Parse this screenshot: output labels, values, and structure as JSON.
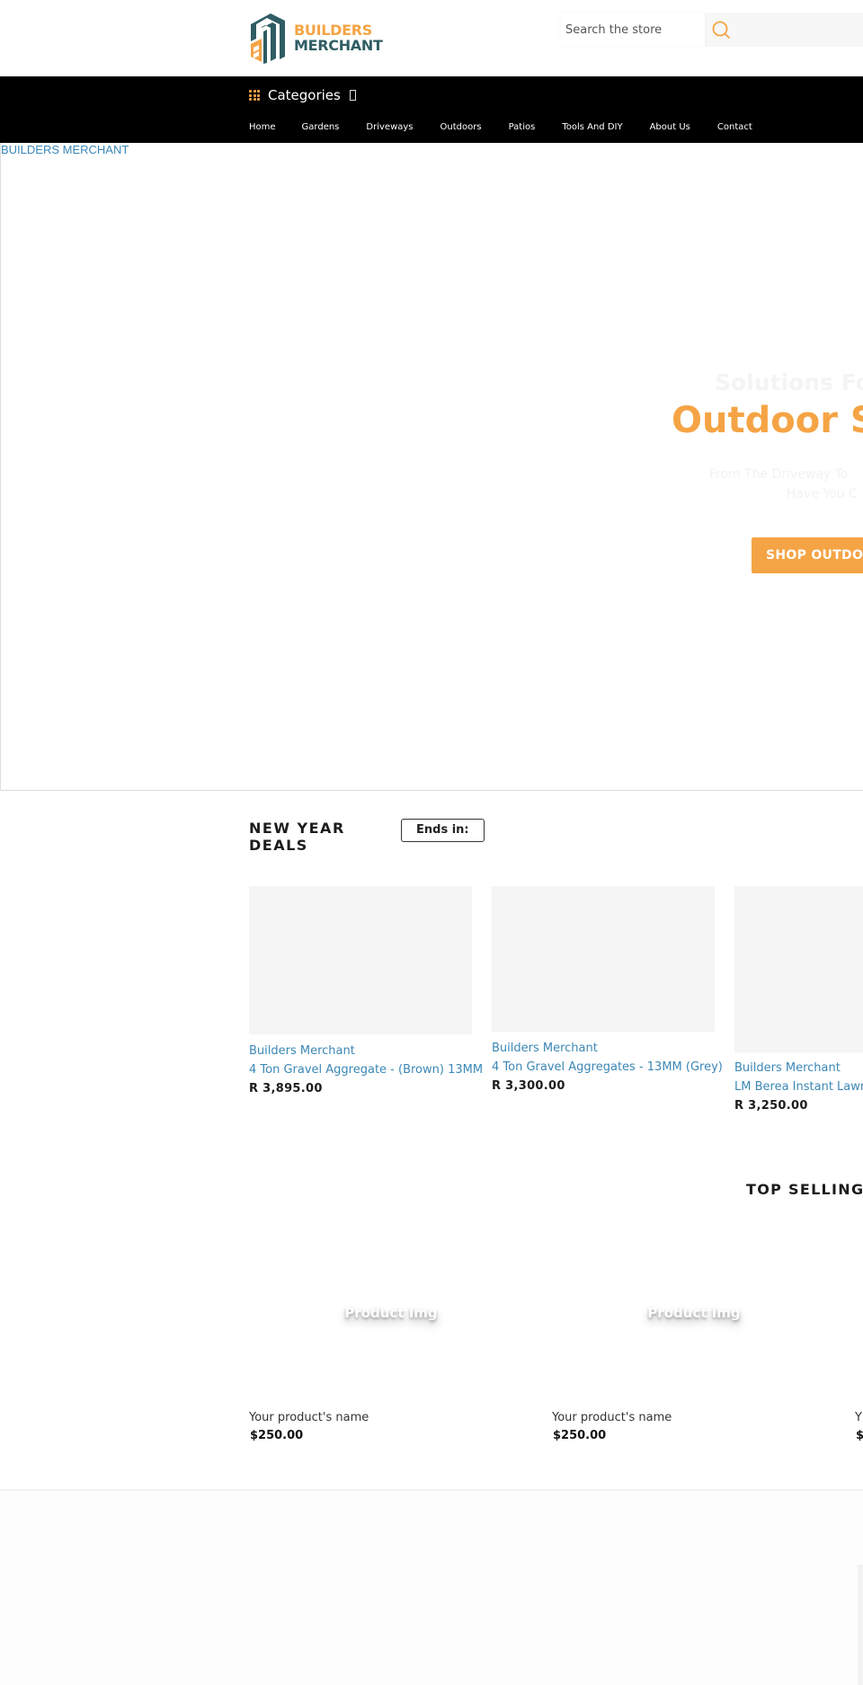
{
  "header": {
    "logo": {
      "line1": "BUILDERS",
      "line2": "MERCHANT",
      "colors": {
        "orange": "#f5a445",
        "teal": "#2f5d63"
      }
    },
    "search": {
      "placeholder": "Search the store",
      "value": "",
      "button_icon": "search-icon"
    }
  },
  "nav": {
    "categories_label": "Categories",
    "categories_icon": "grid-icon",
    "caret_icon": "chevron-down-icon",
    "menu": [
      {
        "label": "Home"
      },
      {
        "label": "Gardens"
      },
      {
        "label": "Driveways"
      },
      {
        "label": "Outdoors"
      },
      {
        "label": "Patios"
      },
      {
        "label": "Tools And DIY"
      },
      {
        "label": "About Us"
      },
      {
        "label": "Contact"
      }
    ]
  },
  "hero": {
    "image_alt": "BUILDERS MERCHANT",
    "subtitle": "Solutions For",
    "title": "Outdoor S",
    "description_line1": "From The Driveway To",
    "description_line2": "Have You C",
    "button_label": "SHOP OUTDOO",
    "accent": "#f5a445"
  },
  "deals": {
    "title": "NEW YEAR DEALS",
    "countdown_label": "Ends in:",
    "products": [
      {
        "vendor": "Builders Merchant",
        "name": "4 Ton Gravel Aggregate - (Brown) 13MM",
        "price": "R 3,895.00"
      },
      {
        "vendor": "Builders Merchant",
        "name": "4 Ton Gravel Aggregates - 13MM (Grey)",
        "price": "R 3,300.00"
      },
      {
        "vendor": "Builders Merchant",
        "name": "LM Berea Instant Lawn -",
        "price": "R 3,250.00"
      }
    ]
  },
  "top_selling": {
    "title": "TOP SELLING P",
    "products": [
      {
        "image_text": "Product Img",
        "name": "Your product's name",
        "price": "$250.00"
      },
      {
        "image_text": "Product Img",
        "name": "Your product's name",
        "price": "$250.00"
      },
      {
        "image_text": "",
        "name": "Y",
        "price": "$"
      }
    ]
  },
  "colors": {
    "link": "#3b87b5",
    "nav_bg": "#000000",
    "accent": "#f5a445"
  }
}
